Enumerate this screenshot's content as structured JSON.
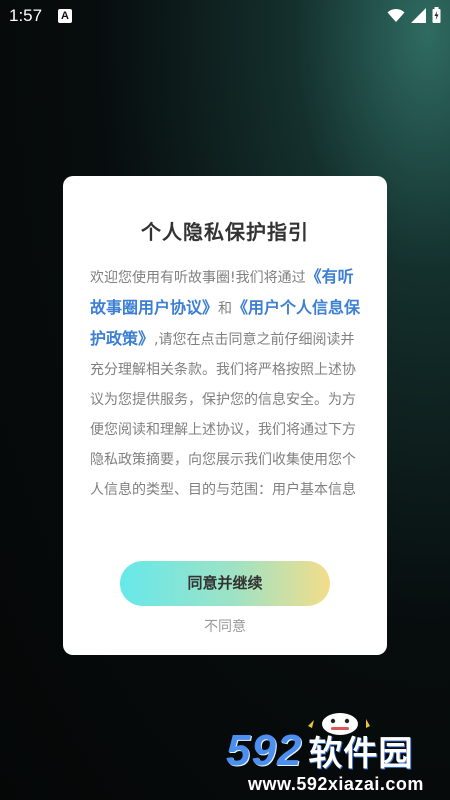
{
  "status_bar": {
    "time": "1:57",
    "notification_badge": "A",
    "icons": [
      "wifi-icon",
      "signal-icon",
      "battery-icon"
    ]
  },
  "dialog": {
    "title": "个人隐私保护指引",
    "text_1": "欢迎您使用有听故事圈!我们将通过",
    "link_user_agreement": "《有听故事圈用户协议》",
    "text_2": "和",
    "link_privacy_policy": "《用户个人信息保护政策》",
    "text_3": ",请您在点击同意之前仔细阅读并充分理解相关条款。我们将严格按照上述协议为您提供服务，保护您的信息安全。为方便您阅读和理解上述协议，我们将通过下方隐私政策摘要，向您展示我们收集使用您个人信息的类型、目的与范围：用户基本信息",
    "agree_button": "同意并继续",
    "disagree_button": "不同意"
  },
  "watermark": {
    "logo_number": "592",
    "logo_text": "软件园",
    "url": "www.592xiazai.com"
  },
  "colors": {
    "link": "#3d7fd3",
    "button_gradient_start": "#66e8ea",
    "button_gradient_end": "#f3dd8a"
  }
}
